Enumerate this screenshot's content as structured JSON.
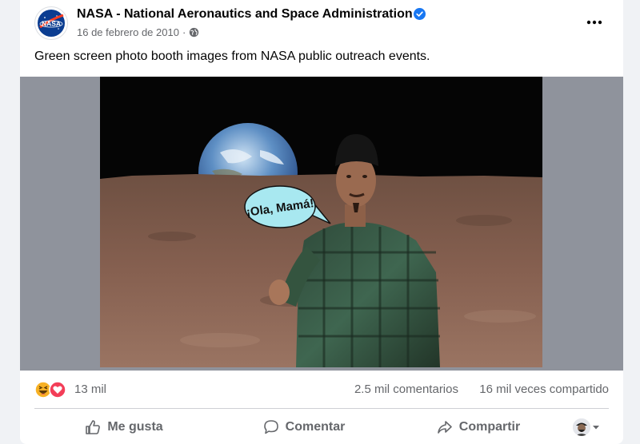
{
  "post": {
    "page_name": "NASA - National Aeronautics and Space Administration",
    "logo_text": "NASA",
    "date": "16 de febrero de 2010",
    "separator": "·",
    "audience_icon": "globe-icon",
    "caption": "Green screen photo booth images from NASA public outreach events.",
    "image": {
      "speech_bubble": "¡Ola, Mamá!"
    }
  },
  "stats": {
    "reactions_count": "13 mil",
    "comments": "2.5 mil comentarios",
    "shares": "16 mil veces compartido",
    "reaction_icons": [
      "haha-icon",
      "love-icon"
    ]
  },
  "actions": {
    "like": "Me gusta",
    "comment": "Comentar",
    "share": "Compartir"
  },
  "colors": {
    "verified": "#1877f2",
    "love": "#f33e58",
    "haha": "#f7b125",
    "secondary_text": "#65676b",
    "image_border": "#8f939c"
  }
}
